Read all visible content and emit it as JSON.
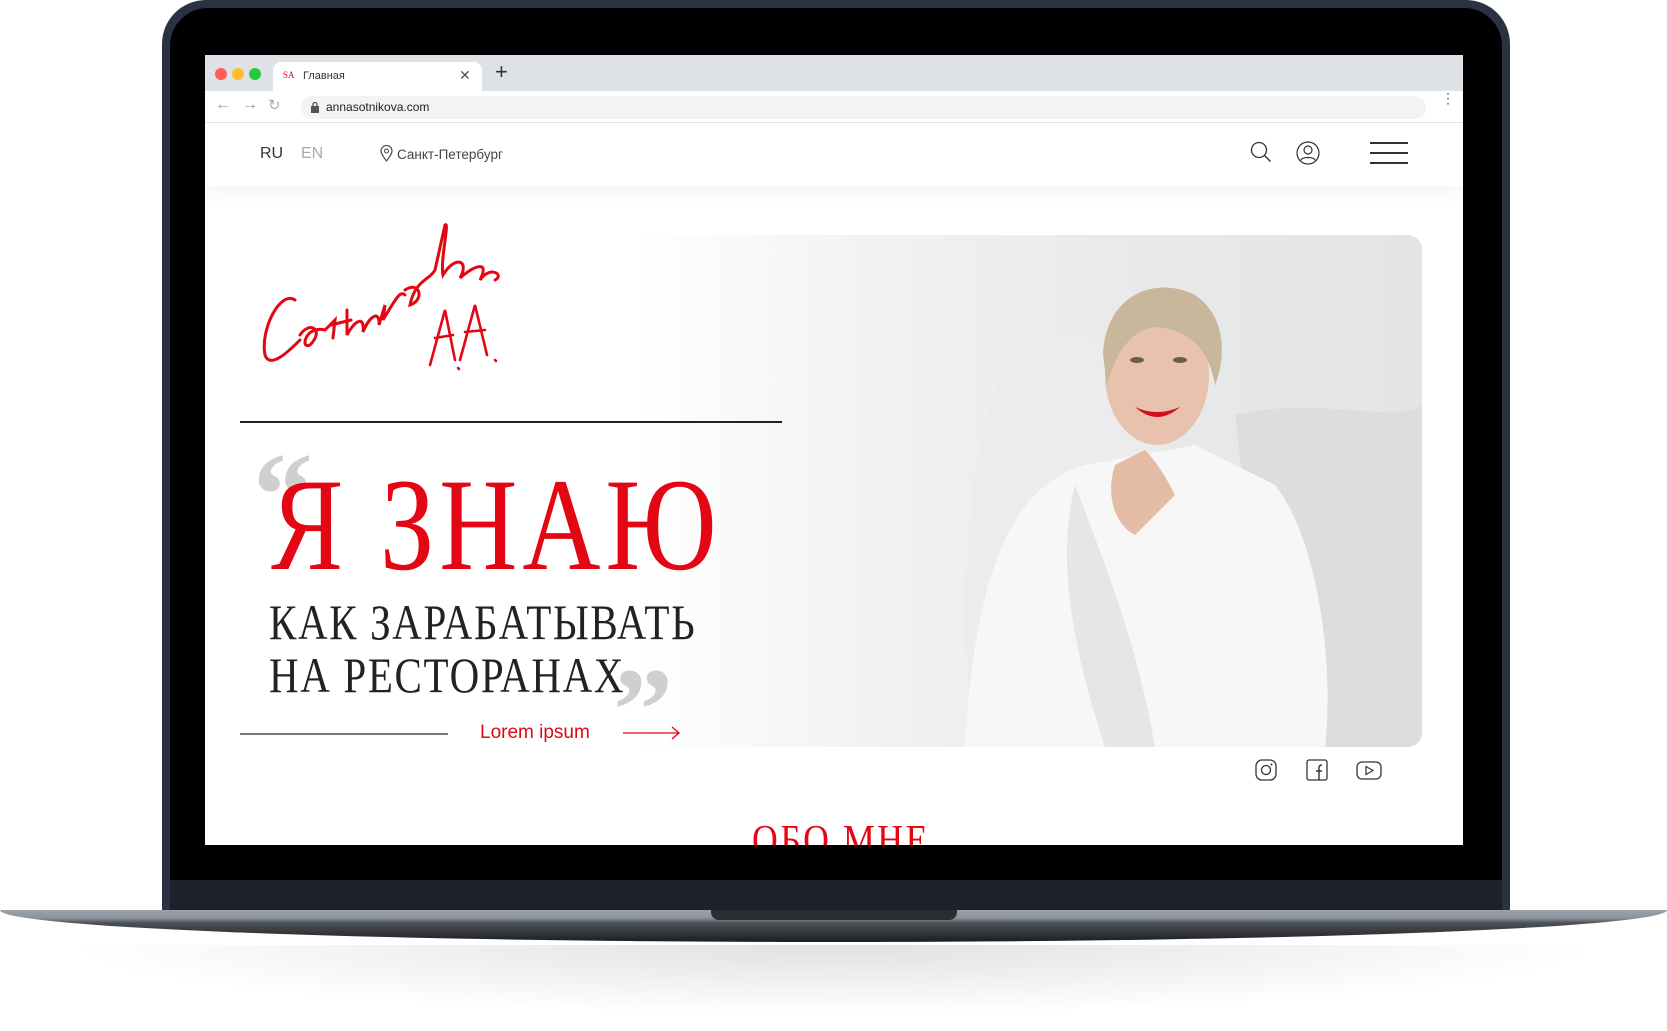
{
  "browser": {
    "tab_favicon": "SA",
    "tab_title": "Главная",
    "url": "annasotnikova.com",
    "colors": {
      "close": "#ff5f57",
      "minimize": "#febc2e",
      "maximize": "#28c840"
    }
  },
  "header": {
    "lang_active": "RU",
    "lang_other": "EN",
    "city": "Санкт-Петербург",
    "icons": [
      "search-icon",
      "user-icon",
      "hamburger-menu-icon"
    ]
  },
  "hero": {
    "signature": "Сотникова А.А.",
    "headline": "Я ЗНАЮ",
    "sub_line1": "КАК ЗАРАБАТЫВАТЬ",
    "sub_line2": "НА РЕСТОРАНАХ",
    "open_quote": "“",
    "close_quote": "”",
    "cta": "Lorem ipsum",
    "accent": "#e30613"
  },
  "social": [
    "instagram-icon",
    "facebook-icon",
    "youtube-icon"
  ],
  "about": {
    "title": "ОБО МНЕ"
  }
}
